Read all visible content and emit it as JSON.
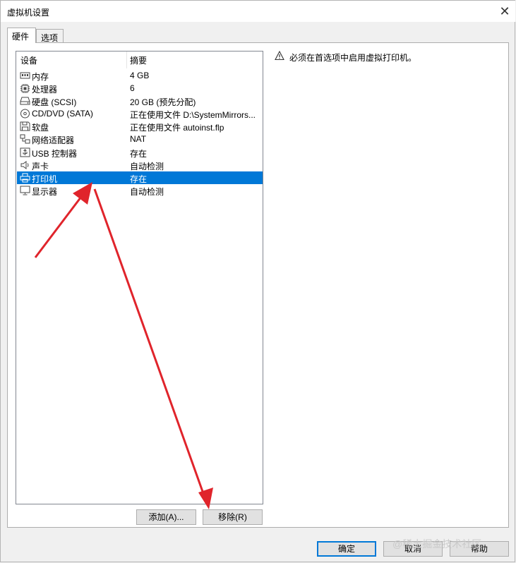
{
  "window": {
    "title": "虚拟机设置",
    "close_glyph": "✕"
  },
  "tabs": [
    {
      "label": "硬件"
    },
    {
      "label": "选项"
    }
  ],
  "device_list": {
    "headers": {
      "device": "设备",
      "summary": "摘要"
    },
    "rows": [
      {
        "icon": "memory-icon",
        "name": "内存",
        "summary": "4 GB"
      },
      {
        "icon": "processor-icon",
        "name": "处理器",
        "summary": "6"
      },
      {
        "icon": "hard-disk-icon",
        "name": "硬盘 (SCSI)",
        "summary": "20 GB (预先分配)"
      },
      {
        "icon": "cd-dvd-icon",
        "name": "CD/DVD (SATA)",
        "summary": "正在使用文件 D:\\SystemMirrors..."
      },
      {
        "icon": "floppy-icon",
        "name": "软盘",
        "summary": "正在使用文件 autoinst.flp"
      },
      {
        "icon": "network-adapter-icon",
        "name": "网络适配器",
        "summary": "NAT"
      },
      {
        "icon": "usb-icon",
        "name": "USB 控制器",
        "summary": "存在"
      },
      {
        "icon": "sound-card-icon",
        "name": "声卡",
        "summary": "自动检测"
      },
      {
        "icon": "printer-icon",
        "name": "打印机",
        "summary": "存在",
        "selected": true
      },
      {
        "icon": "display-icon",
        "name": "显示器",
        "summary": "自动检测"
      }
    ]
  },
  "warning": {
    "icon": "warning-icon",
    "text": "必须在首选项中启用虚拟打印机。"
  },
  "list_buttons": {
    "add": "添加(A)...",
    "remove": "移除(R)"
  },
  "dialog_buttons": {
    "ok": "确定",
    "cancel": "取消",
    "help": "帮助"
  },
  "watermark": "@稀土掘金技术社区",
  "colors": {
    "selection": "#0078d7",
    "annotation_arrow": "#e0242b"
  }
}
